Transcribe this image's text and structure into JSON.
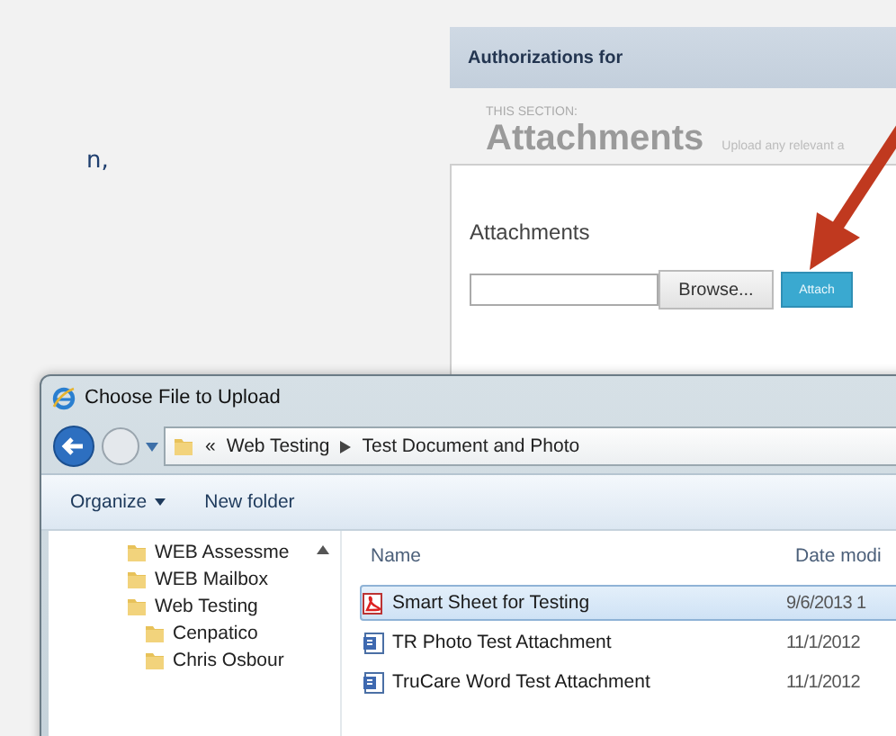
{
  "intro_text": "n,",
  "web_panel": {
    "header": "Authorizations for",
    "section_label": "THIS SECTION:",
    "section_title": "Attachments",
    "section_hint": "Upload any relevant a",
    "field_label": "Attachments",
    "browse_button": "Browse...",
    "attach_button": "Attach"
  },
  "dialog": {
    "title": "Choose File to Upload",
    "breadcrumb_prefix": "«",
    "breadcrumb": [
      {
        "label": "Web Testing"
      },
      {
        "label": "Test Document and Photo"
      }
    ],
    "toolbar": [
      {
        "label": "Organize",
        "menu": true
      },
      {
        "label": "New folder",
        "menu": false
      }
    ],
    "nav_items": [
      {
        "label": "WEB Assessme"
      },
      {
        "label": "WEB Mailbox"
      },
      {
        "label": "Web Testing",
        "children": [
          {
            "label": "Cenpatico"
          },
          {
            "label": "Chris Osbour"
          }
        ]
      }
    ],
    "columns": [
      "Name",
      "Date modi"
    ],
    "files": [
      {
        "name": "Smart Sheet for Testing",
        "modified": "9/6/2013 1",
        "kind": "pdf",
        "selected": true
      },
      {
        "name": "TR Photo Test Attachment",
        "modified": "11/1/2012",
        "kind": "doc",
        "selected": false
      },
      {
        "name": "TruCare  Word Test Attachment",
        "modified": "11/1/2012",
        "kind": "doc",
        "selected": false
      }
    ]
  }
}
